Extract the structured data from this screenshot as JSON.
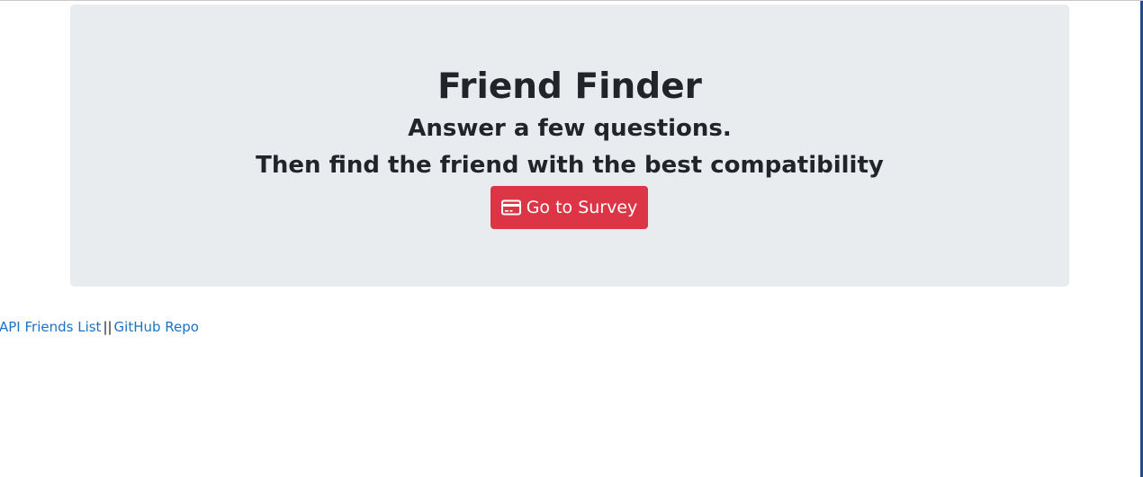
{
  "jumbotron": {
    "title": "Friend Finder",
    "line1": "Answer a few questions.",
    "line2": "Then find the friend with the best compatibility",
    "button": {
      "icon": "credit-card-icon",
      "label": "Go to Survey",
      "color": "#dc3545"
    }
  },
  "footer": {
    "link1": "API Friends List",
    "separator": "||",
    "link2": "GitHub Repo",
    "link_color": "#1a73c7"
  },
  "colors": {
    "jumbotron_bg": "#e9ecef",
    "text": "#212529"
  }
}
